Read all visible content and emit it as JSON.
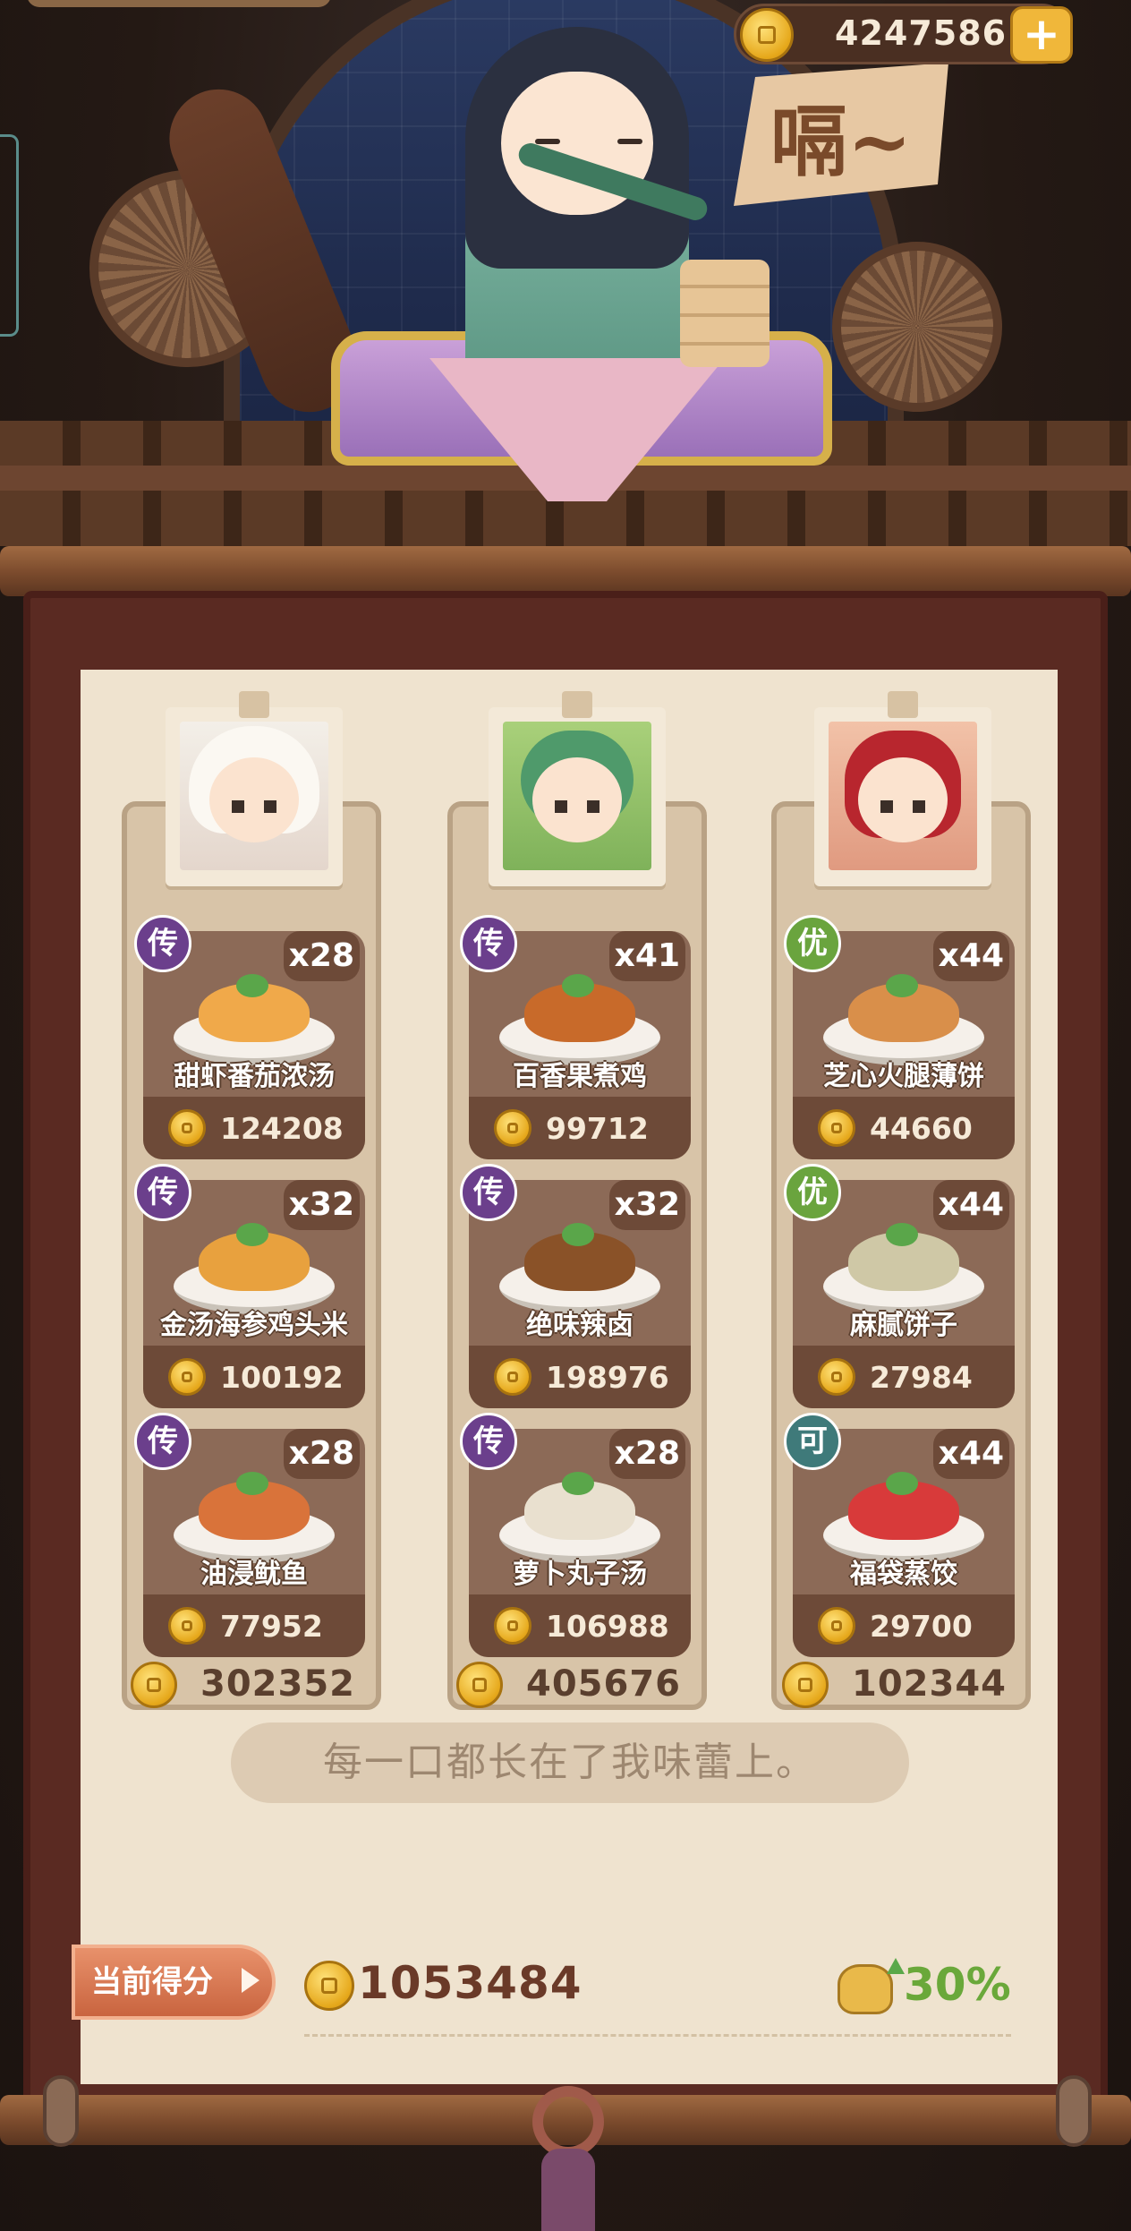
{
  "header": {
    "coin_balance": "4247586",
    "sign_text": "嗝~"
  },
  "columns": [
    {
      "judge": "judge-1",
      "dishes": [
        {
          "rank": "传",
          "rank_color": "#6b3f8c",
          "name": "甜虾番茄浓汤",
          "qty": "x28",
          "price": "124208",
          "food_color": "#f0a94a"
        },
        {
          "rank": "传",
          "rank_color": "#6b3f8c",
          "name": "金汤海参鸡头米",
          "qty": "x32",
          "price": "100192",
          "food_color": "#e8a13e"
        },
        {
          "rank": "传",
          "rank_color": "#6b3f8c",
          "name": "油浸鱿鱼",
          "qty": "x28",
          "price": "77952",
          "food_color": "#d9733a"
        }
      ],
      "total": "302352"
    },
    {
      "judge": "judge-2",
      "dishes": [
        {
          "rank": "传",
          "rank_color": "#6b3f8c",
          "name": "百香果煮鸡",
          "qty": "x41",
          "price": "99712",
          "food_color": "#c86a2a"
        },
        {
          "rank": "传",
          "rank_color": "#6b3f8c",
          "name": "绝味辣卤",
          "qty": "x32",
          "price": "198976",
          "food_color": "#8a5228"
        },
        {
          "rank": "传",
          "rank_color": "#6b3f8c",
          "name": "萝卜丸子汤",
          "qty": "x28",
          "price": "106988",
          "food_color": "#e9e0cf"
        }
      ],
      "total": "405676"
    },
    {
      "judge": "judge-3",
      "dishes": [
        {
          "rank": "优",
          "rank_color": "#6aa43e",
          "name": "芝心火腿薄饼",
          "qty": "x44",
          "price": "44660",
          "food_color": "#d98f4a"
        },
        {
          "rank": "优",
          "rank_color": "#6aa43e",
          "name": "麻腻饼子",
          "qty": "x44",
          "price": "27984",
          "food_color": "#cfc8a6"
        },
        {
          "rank": "可",
          "rank_color": "#3f7a7a",
          "name": "福袋蒸饺",
          "qty": "x44",
          "price": "29700",
          "food_color": "#d83a3a"
        }
      ],
      "total": "102344"
    }
  ],
  "comment": "每一口都长在了我味蕾上。",
  "score": {
    "label": "当前得分",
    "value": "1053484",
    "bonus": "30%"
  }
}
